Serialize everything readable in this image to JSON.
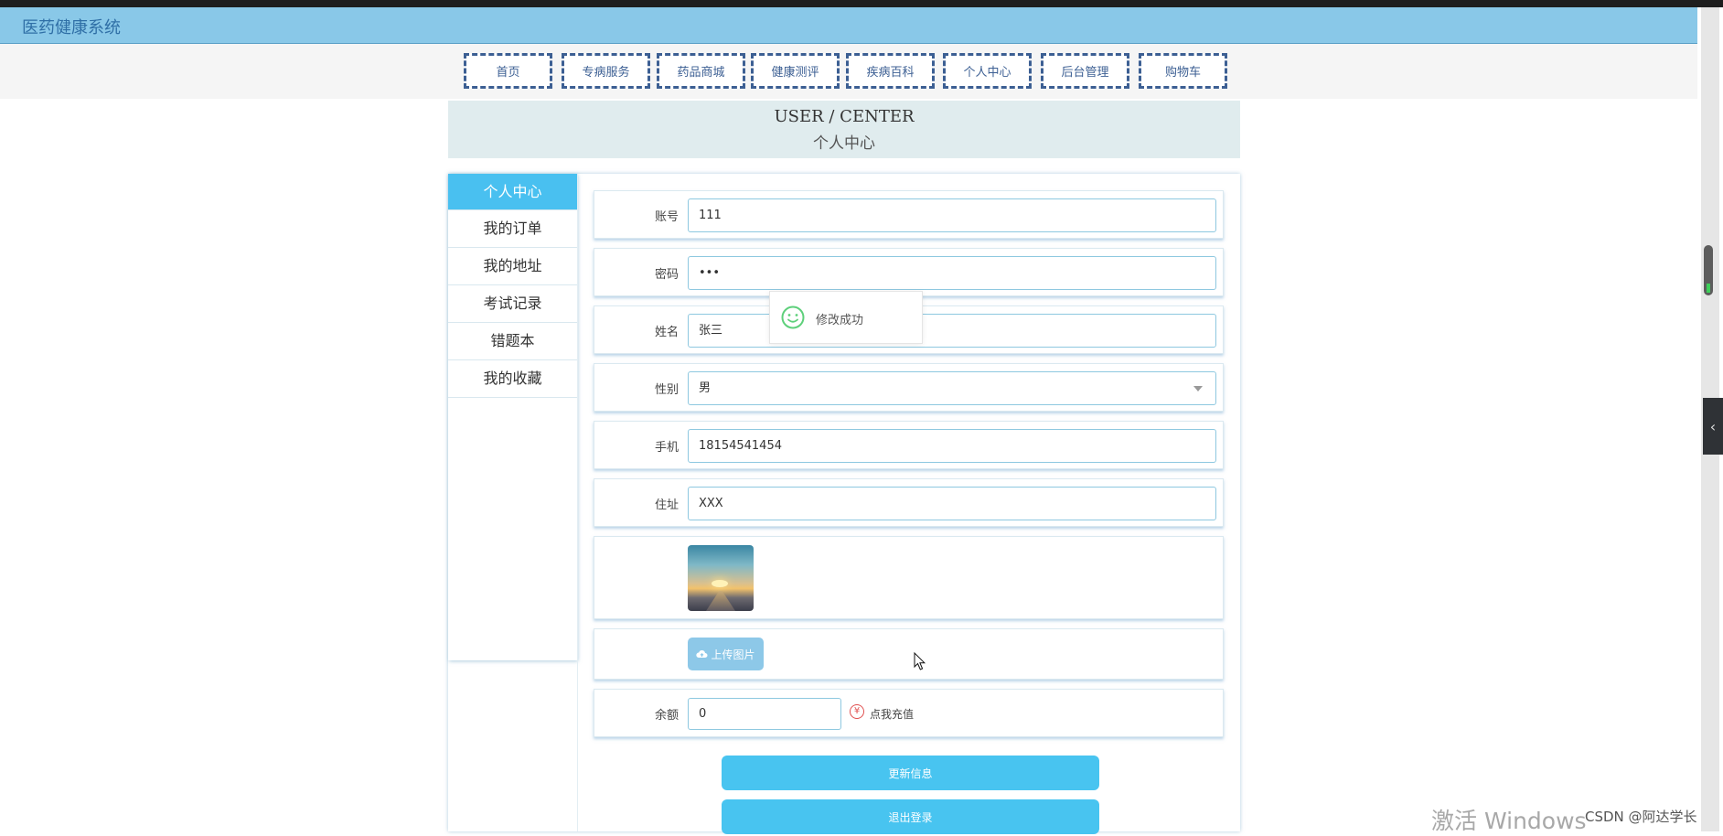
{
  "app": {
    "title": "医药健康系统"
  },
  "nav": {
    "items": [
      {
        "label": "首页"
      },
      {
        "label": "专病服务"
      },
      {
        "label": "药品商城"
      },
      {
        "label": "健康测评"
      },
      {
        "label": "疾病百科"
      },
      {
        "label": "个人中心"
      },
      {
        "label": "后台管理"
      },
      {
        "label": "购物车"
      }
    ]
  },
  "header": {
    "en": "USER / CENTER",
    "cn": "个人中心"
  },
  "sidebar": {
    "items": [
      {
        "label": "个人中心",
        "active": true
      },
      {
        "label": "我的订单"
      },
      {
        "label": "我的地址"
      },
      {
        "label": "考试记录"
      },
      {
        "label": "错题本"
      },
      {
        "label": "我的收藏"
      }
    ]
  },
  "form": {
    "account": {
      "label": "账号",
      "value": "111"
    },
    "password": {
      "label": "密码",
      "value": "•••"
    },
    "name": {
      "label": "姓名",
      "value": "张三"
    },
    "gender": {
      "label": "性别",
      "value": "男"
    },
    "phone": {
      "label": "手机",
      "value": "18154541454"
    },
    "address": {
      "label": "住址",
      "value": "XXX"
    },
    "upload_label": "上传图片",
    "balance": {
      "label": "余额",
      "value": "0"
    },
    "recharge_label": "点我充值",
    "update_button": "更新信息",
    "logout_button": "退出登录"
  },
  "toast": {
    "message": "修改成功"
  },
  "overlay": {
    "watermark": "激活 Windows",
    "credit": "CSDN @阿达学长"
  },
  "colors": {
    "title_bar": "#89c8e8",
    "accent": "#48c4f0",
    "nav_border": "#3c5f93"
  }
}
